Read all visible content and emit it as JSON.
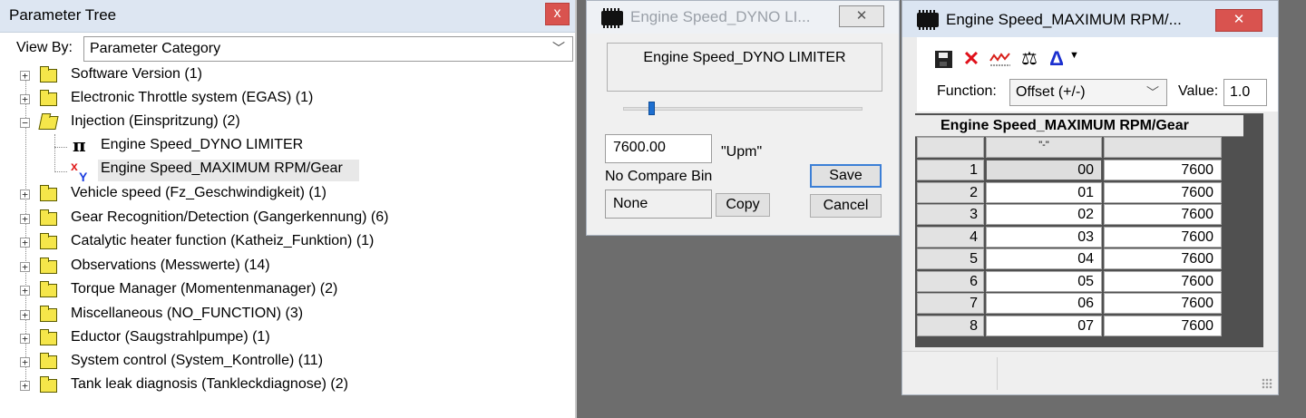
{
  "tree": {
    "title": "Parameter Tree",
    "close_label": "x",
    "view_by_label": "View By:",
    "view_by_value": "Parameter Category",
    "items": [
      {
        "label": "Software Version (1)",
        "expander": "+"
      },
      {
        "label": "Electronic Throttle system (EGAS) (1)",
        "expander": "+"
      },
      {
        "label": "Injection (Einspritzung) (2)",
        "expander": "−"
      },
      {
        "label": "Vehicle speed (Fz_Geschwindigkeit) (1)",
        "expander": "+"
      },
      {
        "label": "Gear Recognition/Detection (Gangerkennung) (6)",
        "expander": "+"
      },
      {
        "label": "Catalytic heater function (Katheiz_Funktion) (1)",
        "expander": "+"
      },
      {
        "label": "Observations (Messwerte) (14)",
        "expander": "+"
      },
      {
        "label": "Torque Manager (Momentenmanager) (2)",
        "expander": "+"
      },
      {
        "label": "Miscellaneous (NO_FUNCTION) (3)",
        "expander": "+"
      },
      {
        "label": "Eductor (Saugstrahlpumpe) (1)",
        "expander": "+"
      },
      {
        "label": "System control (System_Kontrolle) (11)",
        "expander": "+"
      },
      {
        "label": "Tank leak diagnosis (Tankleckdiagnose) (2)",
        "expander": "+"
      }
    ],
    "children": [
      {
        "label": "Engine Speed_DYNO LIMITER",
        "icon": "π"
      },
      {
        "label": "Engine Speed_MAXIMUM RPM/Gear",
        "icon_x": "x",
        "icon_y": "Y"
      }
    ]
  },
  "dyno": {
    "title": "Engine Speed_DYNO LI...",
    "close_label": "✕",
    "param_name": "Engine Speed_DYNO LIMITER",
    "value": "7600.00",
    "unit": "\"Upm\"",
    "compare_label": "No Compare Bin",
    "compare_value": "None",
    "copy_label": "Copy",
    "save_label": "Save",
    "cancel_label": "Cancel",
    "slider_fraction": 0.12
  },
  "rpm": {
    "title": "Engine Speed_MAXIMUM RPM/...",
    "close_label": "✕",
    "function_label": "Function:",
    "function_value": "Offset (+/-)",
    "value_label": "Value:",
    "value": "1.0",
    "grid_title": "Engine Speed_MAXIMUM RPM/Gear",
    "col_header": "\"-\"",
    "rows": [
      {
        "n": "1",
        "gear": "00",
        "rpm": "7600"
      },
      {
        "n": "2",
        "gear": "01",
        "rpm": "7600"
      },
      {
        "n": "3",
        "gear": "02",
        "rpm": "7600"
      },
      {
        "n": "4",
        "gear": "03",
        "rpm": "7600"
      },
      {
        "n": "5",
        "gear": "04",
        "rpm": "7600"
      },
      {
        "n": "6",
        "gear": "05",
        "rpm": "7600"
      },
      {
        "n": "7",
        "gear": "06",
        "rpm": "7600"
      },
      {
        "n": "8",
        "gear": "07",
        "rpm": "7600"
      }
    ]
  },
  "colors": {
    "close_red": "#d9534f",
    "accent_blue": "#1e6fd0",
    "desktop_gray": "#6d6d6d"
  }
}
